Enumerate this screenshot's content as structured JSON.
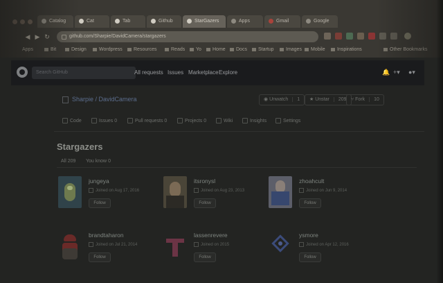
{
  "browser": {
    "tabs": [
      {
        "label": "Catalog",
        "fav": "page",
        "active": false
      },
      {
        "label": "Cat",
        "fav": "github",
        "active": false
      },
      {
        "label": "Tab",
        "fav": "github",
        "active": false
      },
      {
        "label": "Github",
        "fav": "github",
        "active": false
      },
      {
        "label": "StarGazers",
        "fav": "github",
        "active": true
      },
      {
        "label": "Apps",
        "fav": "page",
        "active": false
      },
      {
        "label": "Gmail",
        "fav": "red",
        "active": false
      },
      {
        "label": "Google",
        "fav": "page",
        "active": false
      }
    ],
    "url": "github.com/Sharpie/DavidCamera/stargazers",
    "bookmarks": [
      "Apps",
      "Bit",
      "Design",
      "Wordpress",
      "Resources",
      "Reads",
      "Yo",
      "Home",
      "Docs",
      "Startup",
      "Images",
      "Mobile",
      "Inspirations",
      "Other Bookmarks"
    ]
  },
  "github": {
    "search_placeholder": "Search GitHub",
    "nav": [
      "All requests",
      "Issues",
      "Marketplace",
      "Explore"
    ],
    "repo_path": "Sharpie / DavidCamera",
    "social": [
      {
        "label": "Unwatch",
        "count": "1"
      },
      {
        "label": "Unstar",
        "count": "209"
      },
      {
        "label": "Fork",
        "count": "10"
      }
    ],
    "repo_tabs": [
      {
        "label": "Code"
      },
      {
        "label": "Issues",
        "count": "0"
      },
      {
        "label": "Pull requests",
        "count": "0"
      },
      {
        "label": "Projects",
        "count": "0"
      },
      {
        "label": "Wiki"
      },
      {
        "label": "Insights"
      },
      {
        "label": "Settings"
      }
    ],
    "page_title": "Stargazers",
    "subtabs": [
      {
        "label": "All",
        "count": "209"
      },
      {
        "label": "You know",
        "count": "0"
      }
    ],
    "stargazers": [
      {
        "username": "jungeya",
        "meta": "Joined on Aug 17, 2016",
        "follow": "Follow"
      },
      {
        "username": "itsronysl",
        "meta": "Joined on Aug 23, 2013",
        "follow": "Follow"
      },
      {
        "username": "zhoahcult",
        "meta": "Joined on Jun 9, 2014",
        "follow": "Follow"
      },
      {
        "username": "brandtaharon",
        "meta": "Joined on Jul 21, 2014",
        "follow": "Follow"
      },
      {
        "username": "lassenrevere",
        "meta": "Joined on 2015",
        "follow": "Follow"
      },
      {
        "username": "ysmore",
        "meta": "Joined on Apr 12, 2016",
        "follow": "Follow"
      }
    ]
  }
}
